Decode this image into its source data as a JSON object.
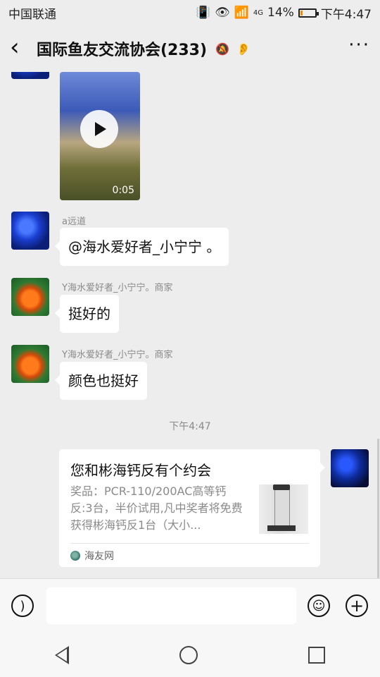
{
  "status_bar": {
    "carrier": "中国联通",
    "network": "4G",
    "battery": "14%",
    "battery_level": 0.14,
    "time": "下午4:47"
  },
  "header": {
    "title": "国际鱼友交流协会(233)"
  },
  "messages": [
    {
      "type": "video",
      "duration": "0:05"
    },
    {
      "type": "text",
      "sender": "a远道",
      "text": "@海水爱好者_小宁宁 。"
    },
    {
      "type": "text",
      "sender": "Y海水爱好者_小宁宁。商家",
      "text": "挺好的"
    },
    {
      "type": "text",
      "sender": "Y海水爱好者_小宁宁。商家",
      "text": "颜色也挺好"
    }
  ],
  "timestamp": "下午4:47",
  "card": {
    "title": "您和彬海钙反有个约会",
    "description": "奖品：PCR-110/200AC高等钙反:3台，半价试用,凡中奖者将免费获得彬海钙反1台（大小...",
    "source": "海友网"
  },
  "input": {
    "placeholder": ""
  },
  "colors": {
    "background": "#ededed",
    "bubble": "#ffffff",
    "accent_battery": "#f08a00"
  }
}
